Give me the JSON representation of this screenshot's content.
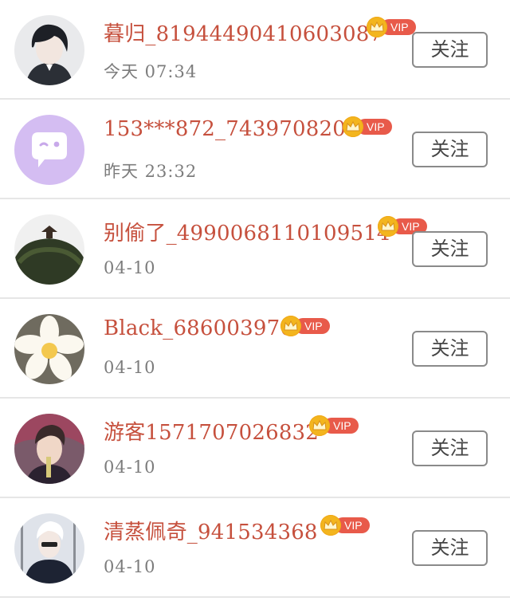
{
  "users": [
    {
      "name": "暮归_81944490410603087",
      "time": "今天  07:34",
      "vip_label": "VIP",
      "follow_label": "关注",
      "avatar": "avatar-anime-boy"
    },
    {
      "name": "153***872_7439708204",
      "time": "昨天  23:32",
      "vip_label": "VIP",
      "follow_label": "关注",
      "avatar": "avatar-chat-bubble"
    },
    {
      "name": "别偷了_4990068110109514",
      "time": "04-10",
      "vip_label": "VIP",
      "follow_label": "关注",
      "avatar": "avatar-hill-pavilion"
    },
    {
      "name": "Black_686003970",
      "time": "04-10",
      "vip_label": "VIP",
      "follow_label": "关注",
      "avatar": "avatar-plumeria-flower"
    },
    {
      "name": "游客1571707026832",
      "time": "04-10",
      "vip_label": "VIP",
      "follow_label": "关注",
      "avatar": "avatar-young-man"
    },
    {
      "name": "清蒸佩奇_941534368",
      "time": "04-10",
      "vip_label": "VIP",
      "follow_label": "关注",
      "avatar": "avatar-white-hair-man"
    }
  ],
  "colors": {
    "name": "#c6503d",
    "time": "#7c7c7c",
    "vip_pill": "#e85a4a",
    "vip_crown": "#f3b51e",
    "button_border": "#8a8a8a",
    "divider": "#e6e6e6"
  }
}
